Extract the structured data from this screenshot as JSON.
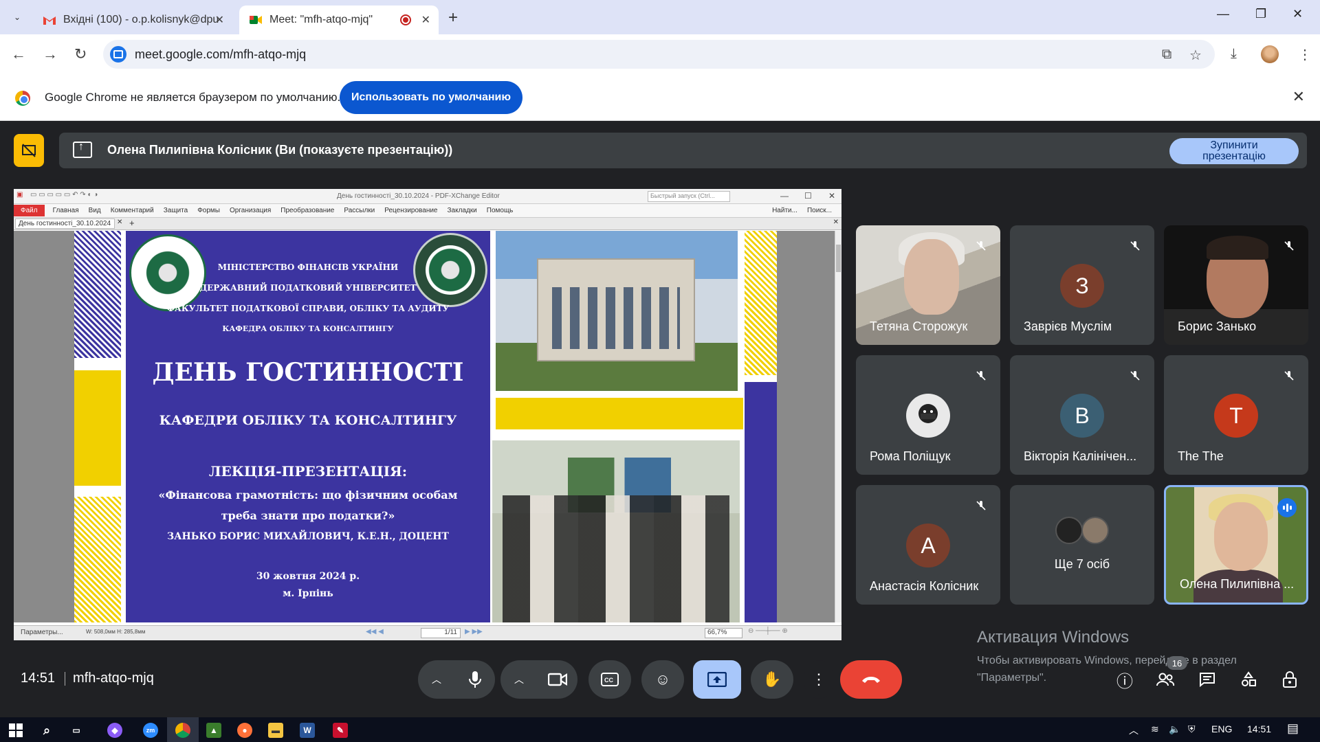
{
  "browser": {
    "tabs": [
      {
        "label": "Вхідні (100) - o.p.kolisnyk@dpu",
        "icon": "gmail-icon"
      },
      {
        "label": "Meet: \"mfh-atqo-mjq\"",
        "icon": "meet-icon"
      }
    ],
    "url": "meet.google.com/mfh-atqo-mjq",
    "infobar_text": "Google Chrome не является браузером по умолчанию.",
    "infobar_button": "Использовать по умолчанию"
  },
  "meet": {
    "presenting_banner": "Олена Пилипівна Колісник (Ви (показуєте презентацію))",
    "stop_presenting_line1": "Зупинити",
    "stop_presenting_line2": "презентацію",
    "time": "14:51",
    "meeting_code": "mfh-atqo-mjq",
    "participant_count": "16",
    "participants": [
      {
        "name": "Тетяна Сторожук",
        "type": "video",
        "muted": true
      },
      {
        "name": "Заврієв Муслім",
        "initial": "З",
        "color": "#7a3e2c",
        "muted": true
      },
      {
        "name": "Борис Занько",
        "type": "video",
        "muted": true
      },
      {
        "name": "Рома Поліщук",
        "type": "avatar-image",
        "muted": true
      },
      {
        "name": "Вікторія Калінічен...",
        "initial": "В",
        "color": "#3b5f73",
        "muted": true
      },
      {
        "name": "The The",
        "initial": "T",
        "color": "#c5391b",
        "muted": true
      },
      {
        "name": "Анастасія Колісник",
        "initial": "А",
        "color": "#7a3e2c",
        "muted": true
      },
      {
        "name": "Ще 7 осіб",
        "type": "group"
      },
      {
        "name": "Олена Пилипівна ...",
        "type": "video",
        "speaking": true
      }
    ],
    "watermark_title": "Активация Windows",
    "watermark_text": "Чтобы активировать Windows, перейдите в раздел \"Параметры\"."
  },
  "pdf_viewer": {
    "window_title": "День гостинності_30.10.2024 - PDF-XChange Editor",
    "quick_launch": "Быстрый запуск (Ctrl...",
    "menu": [
      "Файл",
      "Главная",
      "Вид",
      "Комментарий",
      "Защита",
      "Формы",
      "Организация",
      "Преобразование",
      "Рассылки",
      "Рецензирование",
      "Закладки",
      "Помощь"
    ],
    "menu_right": [
      "Найти...",
      "Поиск..."
    ],
    "doc_tab": "День гостинності_30.10.2024",
    "page": "1/11",
    "zoom": "66,7%",
    "status_left": "Параметры...",
    "status_dims": "W: 508,0мм  H: 285,8мм"
  },
  "slide": {
    "line1": "МІНІСТЕРСТВО ФІНАНСІВ УКРАЇНИ",
    "line2": "ДЕРЖАВНИЙ ПОДАТКОВИЙ УНІВЕРСИТЕТ",
    "line3": "ФАКУЛЬТЕТ ПОДАТКОВОЇ СПРАВИ, ОБЛІКУ ТА АУДИТУ",
    "line4": "КАФЕДРА ОБЛІКУ ТА КОНСАЛТИНГУ",
    "title": "ДЕНЬ ГОСТИННОСТІ",
    "subtitle": "КАФЕДРИ ОБЛІКУ ТА КОНСАЛТИНГУ",
    "lecture": "ЛЕКЦІЯ-ПРЕЗЕНТАЦІЯ:",
    "topic1": "«Фінансова грамотність: що фізичним особам",
    "topic2": "треба знати про податки?»",
    "author": "ЗАНЬКО БОРИС МИХАЙЛОВИЧ, К.Е.Н., ДОЦЕНТ",
    "date": "30 жовтня 2024 р.",
    "city": "м. Ірпінь"
  },
  "taskbar": {
    "lang": "ENG",
    "time": "14:51"
  }
}
